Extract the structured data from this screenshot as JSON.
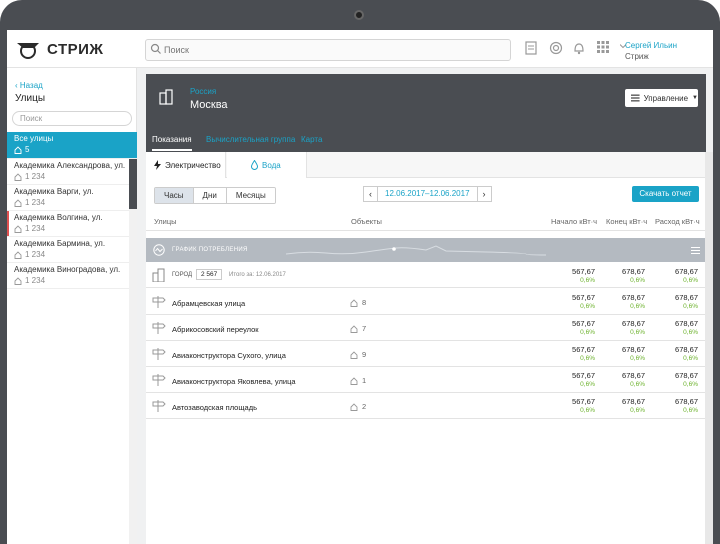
{
  "app": {
    "logo": "СТРИЖ",
    "search_placeholder": "Поиск"
  },
  "user": {
    "name": "Сергей Ильин",
    "org": "Стриж"
  },
  "sidebar": {
    "back": "Назад",
    "title": "Улицы",
    "search_placeholder": "Поиск",
    "items": [
      {
        "name": "Все улицы",
        "count": "5"
      },
      {
        "name": "Академика Александрова, ул.",
        "count": "1 234"
      },
      {
        "name": "Академика Варги, ул.",
        "count": "1 234"
      },
      {
        "name": "Академика Волгина, ул.",
        "count": "1 234"
      },
      {
        "name": "Академика Бармина, ул.",
        "count": "1 234"
      },
      {
        "name": "Академика Виноградова, ул.",
        "count": "1 234"
      }
    ]
  },
  "header": {
    "region": "Россия",
    "city": "Москва",
    "management": "Управление"
  },
  "tabs": [
    "Показания",
    "Вычислительная группа",
    "Карта"
  ],
  "resource_tabs": {
    "electricity": "Электричество",
    "water": "Вода"
  },
  "period": [
    "Часы",
    "Дни",
    "Месяцы"
  ],
  "date_range": "12.06.2017–12.06.2017",
  "download": "Скачать отчет",
  "columns": {
    "streets": "Улицы",
    "objects": "Объекты",
    "start": "Начало кВт·ч",
    "end": "Конец кВт·ч",
    "consumption": "Расход кВт·ч"
  },
  "graph_label": "ГРАФИК ПОТРЕБЛЕНИЯ",
  "city_row": {
    "label": "ГОРОД",
    "count": "2 567",
    "total": "Итого за: 12.06.2017",
    "start": "567,67",
    "start_pct": "0,6%",
    "end": "678,67",
    "end_pct": "0,6%",
    "cons": "678,67",
    "cons_pct": "0,6%"
  },
  "rows": [
    {
      "name": "Абрамцевская улица",
      "objects": "8",
      "start": "567,67",
      "start_pct": "0,6%",
      "end": "678,67",
      "end_pct": "0,6%",
      "cons": "678,67",
      "cons_pct": "0,6%"
    },
    {
      "name": "Абрикосовский переулок",
      "objects": "7",
      "start": "567,67",
      "start_pct": "0,6%",
      "end": "678,67",
      "end_pct": "0,6%",
      "cons": "678,67",
      "cons_pct": "0,6%"
    },
    {
      "name": "Авиаконструктора Сухого, улица",
      "objects": "9",
      "start": "567,67",
      "start_pct": "0,6%",
      "end": "678,67",
      "end_pct": "0,6%",
      "cons": "678,67",
      "cons_pct": "0,6%"
    },
    {
      "name": "Авиаконструктора Яковлева, улица",
      "objects": "1",
      "start": "567,67",
      "start_pct": "0,6%",
      "end": "678,67",
      "end_pct": "0,6%",
      "cons": "678,67",
      "cons_pct": "0,6%"
    },
    {
      "name": "Автозаводская площадь",
      "objects": "2",
      "start": "567,67",
      "start_pct": "0,6%",
      "end": "678,67",
      "end_pct": "0,6%",
      "cons": "678,67",
      "cons_pct": "0,6%"
    }
  ]
}
